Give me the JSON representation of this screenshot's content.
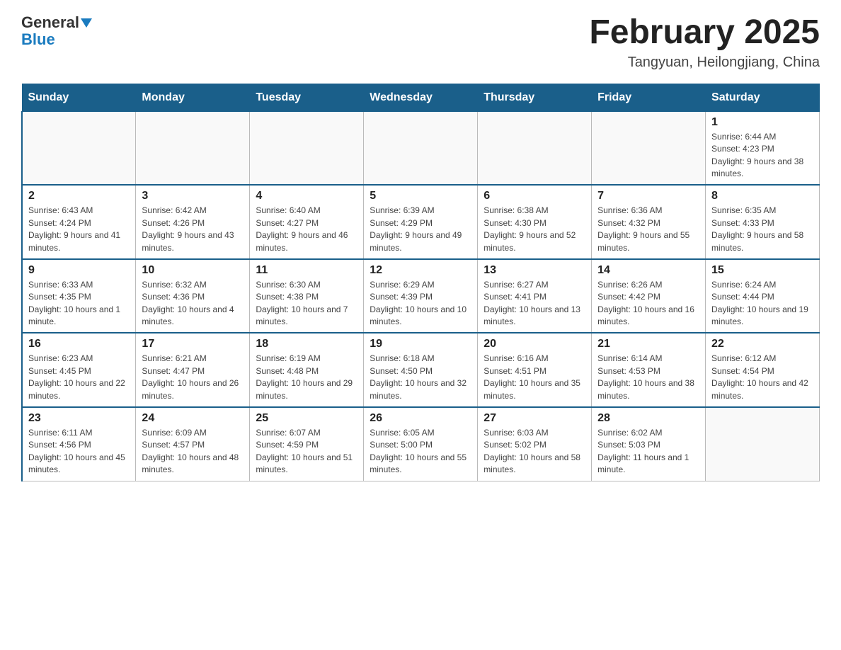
{
  "logo": {
    "general": "General",
    "blue": "Blue"
  },
  "title": "February 2025",
  "subtitle": "Tangyuan, Heilongjiang, China",
  "days_of_week": [
    "Sunday",
    "Monday",
    "Tuesday",
    "Wednesday",
    "Thursday",
    "Friday",
    "Saturday"
  ],
  "weeks": [
    [
      {
        "day": "",
        "info": ""
      },
      {
        "day": "",
        "info": ""
      },
      {
        "day": "",
        "info": ""
      },
      {
        "day": "",
        "info": ""
      },
      {
        "day": "",
        "info": ""
      },
      {
        "day": "",
        "info": ""
      },
      {
        "day": "1",
        "info": "Sunrise: 6:44 AM\nSunset: 4:23 PM\nDaylight: 9 hours and 38 minutes."
      }
    ],
    [
      {
        "day": "2",
        "info": "Sunrise: 6:43 AM\nSunset: 4:24 PM\nDaylight: 9 hours and 41 minutes."
      },
      {
        "day": "3",
        "info": "Sunrise: 6:42 AM\nSunset: 4:26 PM\nDaylight: 9 hours and 43 minutes."
      },
      {
        "day": "4",
        "info": "Sunrise: 6:40 AM\nSunset: 4:27 PM\nDaylight: 9 hours and 46 minutes."
      },
      {
        "day": "5",
        "info": "Sunrise: 6:39 AM\nSunset: 4:29 PM\nDaylight: 9 hours and 49 minutes."
      },
      {
        "day": "6",
        "info": "Sunrise: 6:38 AM\nSunset: 4:30 PM\nDaylight: 9 hours and 52 minutes."
      },
      {
        "day": "7",
        "info": "Sunrise: 6:36 AM\nSunset: 4:32 PM\nDaylight: 9 hours and 55 minutes."
      },
      {
        "day": "8",
        "info": "Sunrise: 6:35 AM\nSunset: 4:33 PM\nDaylight: 9 hours and 58 minutes."
      }
    ],
    [
      {
        "day": "9",
        "info": "Sunrise: 6:33 AM\nSunset: 4:35 PM\nDaylight: 10 hours and 1 minute."
      },
      {
        "day": "10",
        "info": "Sunrise: 6:32 AM\nSunset: 4:36 PM\nDaylight: 10 hours and 4 minutes."
      },
      {
        "day": "11",
        "info": "Sunrise: 6:30 AM\nSunset: 4:38 PM\nDaylight: 10 hours and 7 minutes."
      },
      {
        "day": "12",
        "info": "Sunrise: 6:29 AM\nSunset: 4:39 PM\nDaylight: 10 hours and 10 minutes."
      },
      {
        "day": "13",
        "info": "Sunrise: 6:27 AM\nSunset: 4:41 PM\nDaylight: 10 hours and 13 minutes."
      },
      {
        "day": "14",
        "info": "Sunrise: 6:26 AM\nSunset: 4:42 PM\nDaylight: 10 hours and 16 minutes."
      },
      {
        "day": "15",
        "info": "Sunrise: 6:24 AM\nSunset: 4:44 PM\nDaylight: 10 hours and 19 minutes."
      }
    ],
    [
      {
        "day": "16",
        "info": "Sunrise: 6:23 AM\nSunset: 4:45 PM\nDaylight: 10 hours and 22 minutes."
      },
      {
        "day": "17",
        "info": "Sunrise: 6:21 AM\nSunset: 4:47 PM\nDaylight: 10 hours and 26 minutes."
      },
      {
        "day": "18",
        "info": "Sunrise: 6:19 AM\nSunset: 4:48 PM\nDaylight: 10 hours and 29 minutes."
      },
      {
        "day": "19",
        "info": "Sunrise: 6:18 AM\nSunset: 4:50 PM\nDaylight: 10 hours and 32 minutes."
      },
      {
        "day": "20",
        "info": "Sunrise: 6:16 AM\nSunset: 4:51 PM\nDaylight: 10 hours and 35 minutes."
      },
      {
        "day": "21",
        "info": "Sunrise: 6:14 AM\nSunset: 4:53 PM\nDaylight: 10 hours and 38 minutes."
      },
      {
        "day": "22",
        "info": "Sunrise: 6:12 AM\nSunset: 4:54 PM\nDaylight: 10 hours and 42 minutes."
      }
    ],
    [
      {
        "day": "23",
        "info": "Sunrise: 6:11 AM\nSunset: 4:56 PM\nDaylight: 10 hours and 45 minutes."
      },
      {
        "day": "24",
        "info": "Sunrise: 6:09 AM\nSunset: 4:57 PM\nDaylight: 10 hours and 48 minutes."
      },
      {
        "day": "25",
        "info": "Sunrise: 6:07 AM\nSunset: 4:59 PM\nDaylight: 10 hours and 51 minutes."
      },
      {
        "day": "26",
        "info": "Sunrise: 6:05 AM\nSunset: 5:00 PM\nDaylight: 10 hours and 55 minutes."
      },
      {
        "day": "27",
        "info": "Sunrise: 6:03 AM\nSunset: 5:02 PM\nDaylight: 10 hours and 58 minutes."
      },
      {
        "day": "28",
        "info": "Sunrise: 6:02 AM\nSunset: 5:03 PM\nDaylight: 11 hours and 1 minute."
      },
      {
        "day": "",
        "info": ""
      }
    ]
  ]
}
